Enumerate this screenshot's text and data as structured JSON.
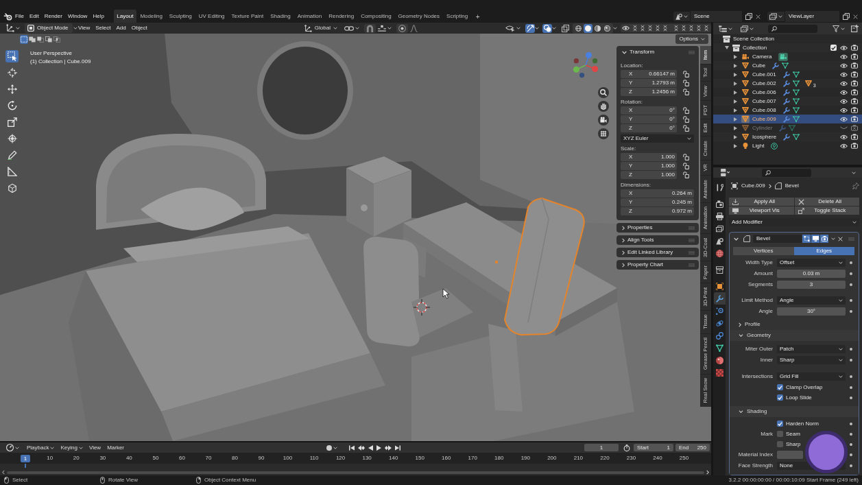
{
  "topbar": {
    "menus": [
      "File",
      "Edit",
      "Render",
      "Window",
      "Help"
    ],
    "workspaces": [
      {
        "label": "Layout",
        "selected": true
      },
      {
        "label": "Modeling",
        "selected": false
      },
      {
        "label": "Sculpting",
        "selected": false
      },
      {
        "label": "UV Editing",
        "selected": false
      },
      {
        "label": "Texture Paint",
        "selected": false
      },
      {
        "label": "Shading",
        "selected": false
      },
      {
        "label": "Animation",
        "selected": false
      },
      {
        "label": "Rendering",
        "selected": false
      },
      {
        "label": "Compositing",
        "selected": false
      },
      {
        "label": "Geometry Nodes",
        "selected": false
      },
      {
        "label": "Scripting",
        "selected": false
      }
    ],
    "add_workspace": "+",
    "scene": "Scene",
    "view_layer": "ViewLayer"
  },
  "viewport_header": {
    "mode": "Object Mode",
    "menus": [
      "View",
      "Select",
      "Add",
      "Object"
    ],
    "orientation": "Global",
    "gizmos": true,
    "overlays": true,
    "xray": false,
    "shading": [
      {
        "kind": "wireframe",
        "selected": false
      },
      {
        "kind": "solid",
        "selected": true
      },
      {
        "kind": "material",
        "selected": false
      },
      {
        "kind": "rendered",
        "selected": false
      }
    ]
  },
  "tool_settings": {
    "select_modes": [
      {
        "kind": "set",
        "selected": true
      },
      {
        "kind": "extend",
        "selected": false
      },
      {
        "kind": "subtract",
        "selected": false
      },
      {
        "kind": "invert",
        "selected": false
      },
      {
        "kind": "intersect",
        "selected": false
      }
    ],
    "options": "Options"
  },
  "toolbar": [
    {
      "kind": "select_box",
      "selected": true
    },
    {
      "kind": "cursor",
      "selected": false
    },
    {
      "kind": "move",
      "selected": false
    },
    {
      "kind": "rotate",
      "selected": false
    },
    {
      "kind": "scale",
      "selected": false
    },
    {
      "kind": "transform",
      "selected": false
    },
    {
      "kind": "annotate",
      "selected": false
    },
    {
      "kind": "measure",
      "selected": false
    },
    {
      "kind": "add_cube",
      "selected": false
    }
  ],
  "viewport": {
    "view_name": "User Perspective",
    "object_info": "(1) Collection | Cube.009"
  },
  "sidebar": {
    "panel": {
      "title": "Transform",
      "expanded": true
    },
    "groups": [
      {
        "label": "Location:",
        "fields": [
          {
            "axis": "X",
            "value": "0.66147 m",
            "locked": false
          },
          {
            "axis": "Y",
            "value": "1.2793 m",
            "locked": false
          },
          {
            "axis": "Z",
            "value": "1.2456 m",
            "locked": false
          }
        ]
      },
      {
        "label": "Rotation:",
        "fields": [
          {
            "axis": "X",
            "value": "0°",
            "locked": false
          },
          {
            "axis": "Y",
            "value": "0°",
            "locked": false
          },
          {
            "axis": "Z",
            "value": "0°",
            "locked": false
          }
        ],
        "mode": "XYZ Euler"
      },
      {
        "label": "Scale:",
        "fields": [
          {
            "axis": "X",
            "value": "1.000",
            "locked": false
          },
          {
            "axis": "Y",
            "value": "1.000",
            "locked": false
          },
          {
            "axis": "Z",
            "value": "1.000",
            "locked": false
          }
        ]
      },
      {
        "label": "Dimensions:",
        "fields": [
          {
            "axis": "X",
            "value": "0.264 m"
          },
          {
            "axis": "Y",
            "value": "0.245 m"
          },
          {
            "axis": "Z",
            "value": "0.972 m"
          }
        ]
      }
    ],
    "collapsed_panels": [
      "Properties",
      "Align Tools",
      "Edit Linked Library",
      "Property Chart"
    ],
    "tabs": [
      {
        "label": "Item",
        "selected": true
      },
      {
        "label": "Tool",
        "selected": false
      },
      {
        "label": "View",
        "selected": false
      },
      {
        "label": "PDT",
        "selected": false
      },
      {
        "label": "Edit",
        "selected": false
      },
      {
        "label": "Create",
        "selected": false
      },
      {
        "label": "VR",
        "selected": false
      },
      {
        "label": "Animate",
        "selected": false
      },
      {
        "label": "Animation",
        "selected": false
      },
      {
        "label": "3D-Coat",
        "selected": false
      },
      {
        "label": "Paper",
        "selected": false
      },
      {
        "label": "3D-Print",
        "selected": false
      },
      {
        "label": "Tissue",
        "selected": false
      },
      {
        "label": "Grease Pencil",
        "selected": false
      },
      {
        "label": "Real Snow",
        "selected": false
      }
    ]
  },
  "outliner": {
    "root": "Scene Collection",
    "collections": [
      {
        "name": "Collection",
        "expanded": true,
        "checked": true,
        "children": [
          {
            "name": "Camera",
            "kind": "camera",
            "expanded": false,
            "modifiers": false,
            "selected": false,
            "hidden": false
          },
          {
            "name": "Cube",
            "kind": "mesh",
            "expanded": false,
            "modifiers": true,
            "selected": false,
            "hidden": false
          },
          {
            "name": "Cube.001",
            "kind": "mesh",
            "expanded": false,
            "modifiers": true,
            "selected": false,
            "hidden": false
          },
          {
            "name": "Cube.002",
            "kind": "mesh",
            "expanded": false,
            "modifiers": true,
            "selected": false,
            "hidden": false,
            "child_count": "3"
          },
          {
            "name": "Cube.006",
            "kind": "mesh",
            "expanded": false,
            "modifiers": true,
            "selected": false,
            "hidden": false
          },
          {
            "name": "Cube.007",
            "kind": "mesh",
            "expanded": false,
            "modifiers": true,
            "selected": false,
            "hidden": false
          },
          {
            "name": "Cube.008",
            "kind": "mesh",
            "expanded": false,
            "modifiers": true,
            "selected": false,
            "hidden": false
          },
          {
            "name": "Cube.009",
            "kind": "mesh",
            "expanded": false,
            "modifiers": true,
            "selected": true,
            "hidden": false
          },
          {
            "name": "Cylinder",
            "kind": "mesh",
            "expanded": false,
            "modifiers": true,
            "selected": false,
            "hidden": true
          },
          {
            "name": "Icosphere",
            "kind": "mesh",
            "expanded": false,
            "modifiers": true,
            "selected": false,
            "hidden": false
          },
          {
            "name": "Light",
            "kind": "light",
            "expanded": false,
            "modifiers": false,
            "selected": false,
            "hidden": false
          }
        ]
      }
    ]
  },
  "properties": {
    "tabs": [
      {
        "kind": "tool",
        "selected": false
      },
      {
        "kind": "render",
        "selected": false
      },
      {
        "kind": "output",
        "selected": false
      },
      {
        "kind": "view_layer",
        "selected": false
      },
      {
        "kind": "scene",
        "selected": false
      },
      {
        "kind": "world",
        "selected": false
      },
      {
        "kind": "collection",
        "selected": false
      },
      {
        "kind": "object",
        "selected": false
      },
      {
        "kind": "modifiers",
        "selected": true
      },
      {
        "kind": "particles",
        "selected": false
      },
      {
        "kind": "physics",
        "selected": false
      },
      {
        "kind": "constraints",
        "selected": false
      },
      {
        "kind": "data",
        "selected": false
      },
      {
        "kind": "material",
        "selected": false
      },
      {
        "kind": "texture",
        "selected": false
      }
    ],
    "breadcrumb": {
      "object": "Cube.009",
      "modifier": "Bevel"
    },
    "actions": [
      {
        "kind": "apply",
        "label": "Apply All"
      },
      {
        "kind": "delete",
        "label": "Delete All"
      },
      {
        "kind": "viewport",
        "label": "Viewport Vis"
      },
      {
        "kind": "stack",
        "label": "Toggle Stack"
      }
    ],
    "add_modifier": "Add Modifier",
    "modifier": {
      "name": "Bevel",
      "expanded": true,
      "edit_mode": true,
      "viewport": true,
      "render": true,
      "affect": [
        {
          "label": "Vertices",
          "selected": false
        },
        {
          "label": "Edges",
          "selected": true
        }
      ],
      "sections": [
        {
          "kind": "rows",
          "blocks": [
            [
              {
                "kind": "dropdown",
                "label": "Width Type",
                "value": "Offset"
              },
              {
                "kind": "number",
                "label": "Amount",
                "value": "0.03 m"
              },
              {
                "kind": "number",
                "label": "Segments",
                "value": "3"
              }
            ],
            [
              {
                "kind": "dropdown",
                "label": "Limit Method",
                "value": "Angle"
              },
              {
                "kind": "number",
                "label": "Angle",
                "value": "30°"
              }
            ]
          ]
        },
        {
          "kind": "subpanel",
          "title": "Profile",
          "expanded": false
        },
        {
          "kind": "subpanel",
          "title": "Geometry",
          "expanded": true,
          "blocks": [
            [
              {
                "kind": "dropdown",
                "label": "Miter Outer",
                "value": "Patch"
              },
              {
                "kind": "dropdown",
                "label": "Inner",
                "value": "Sharp"
              }
            ],
            [
              {
                "kind": "dropdown",
                "label": "Intersections",
                "value": "Grid Fill"
              },
              {
                "kind": "checkbox",
                "text": "Clamp Overlap",
                "checked": true
              },
              {
                "kind": "checkbox",
                "text": "Loop Slide",
                "checked": true
              }
            ]
          ]
        },
        {
          "kind": "subpanel",
          "title": "Shading",
          "expanded": true,
          "blocks": [
            [
              {
                "kind": "checkbox",
                "text": "Harden Norm",
                "checked": true
              },
              {
                "kind": "checkbox",
                "label": "Mark",
                "text": "Seam",
                "checked": false
              },
              {
                "kind": "checkbox",
                "text": "Sharp",
                "checked": false
              },
              {
                "kind": "number",
                "label": "Material Index"
              },
              {
                "kind": "dropdown",
                "label": "Face Strength",
                "value": "None"
              }
            ]
          ]
        }
      ]
    }
  },
  "timeline": {
    "menus": [
      {
        "label": "Playback",
        "dropdown": true
      },
      {
        "label": "Keying",
        "dropdown": true
      },
      {
        "label": "View",
        "dropdown": false
      },
      {
        "label": "Marker",
        "dropdown": false
      }
    ],
    "auto_key": false,
    "current_frame": "1",
    "start_label": "Start",
    "start": "1",
    "end_label": "End",
    "end": "250",
    "ruler": {
      "current": "1",
      "ticks": [
        "10",
        "20",
        "30",
        "40",
        "50",
        "60",
        "70",
        "80",
        "90",
        "100",
        "110",
        "120",
        "130",
        "140",
        "150",
        "160",
        "170",
        "180",
        "190",
        "200",
        "210",
        "220",
        "230",
        "240",
        "250"
      ]
    }
  },
  "status_bar": {
    "hints": [
      {
        "kind": "left",
        "text": "Select"
      },
      {
        "kind": "middle",
        "text": "Rotate View"
      },
      {
        "kind": "right",
        "text": "Object Context Menu"
      }
    ],
    "info": "3.2.2 00:00:00:00 / 00:00:10:09 Start Frame (249 left)"
  }
}
